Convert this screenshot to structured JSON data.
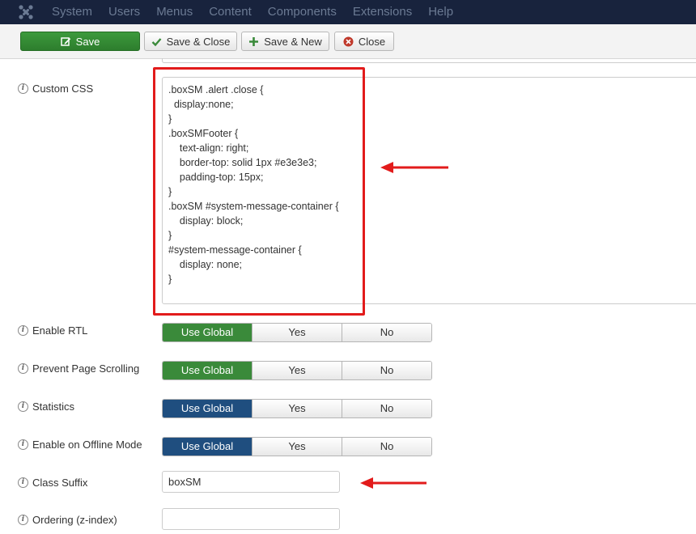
{
  "topnav": {
    "logo_icon": "joomla-logo-icon",
    "items": [
      {
        "label": "System"
      },
      {
        "label": "Users"
      },
      {
        "label": "Menus"
      },
      {
        "label": "Content"
      },
      {
        "label": "Components"
      },
      {
        "label": "Extensions"
      },
      {
        "label": "Help"
      }
    ]
  },
  "toolbar": {
    "save_label": "Save",
    "save_close_label": "Save & Close",
    "save_new_label": "Save & New",
    "close_label": "Close"
  },
  "form": {
    "custom_css": {
      "label": "Custom CSS",
      "value": ".boxSM .alert .close {\n  display:none;\n}\n.boxSMFooter {\n    text-align: right;\n    border-top: solid 1px #e3e3e3;\n    padding-top: 15px;\n}\n.boxSM #system-message-container {\n    display: block;\n}\n#system-message-container {\n    display: none;\n}"
    },
    "toggles": [
      {
        "label": "Enable RTL",
        "options": [
          "Use Global",
          "Yes",
          "No"
        ],
        "selected": "Use Global",
        "active_color": "#3a8a3a"
      },
      {
        "label": "Prevent Page Scrolling",
        "options": [
          "Use Global",
          "Yes",
          "No"
        ],
        "selected": "Use Global",
        "active_color": "#3a8a3a"
      },
      {
        "label": "Statistics",
        "options": [
          "Use Global",
          "Yes",
          "No"
        ],
        "selected": "Use Global",
        "active_color": "#1f4e7f"
      },
      {
        "label": "Enable on Offline Mode",
        "options": [
          "Use Global",
          "Yes",
          "No"
        ],
        "selected": "Use Global",
        "active_color": "#1f4e7f"
      }
    ],
    "class_suffix": {
      "label": "Class Suffix",
      "value": "boxSM"
    },
    "ordering": {
      "label": "Ordering (z-index)",
      "value": ""
    }
  },
  "colors": {
    "nav_bg": "#18233d",
    "save_green": "#2d7d2d",
    "annotation_red": "#e21b1b"
  }
}
